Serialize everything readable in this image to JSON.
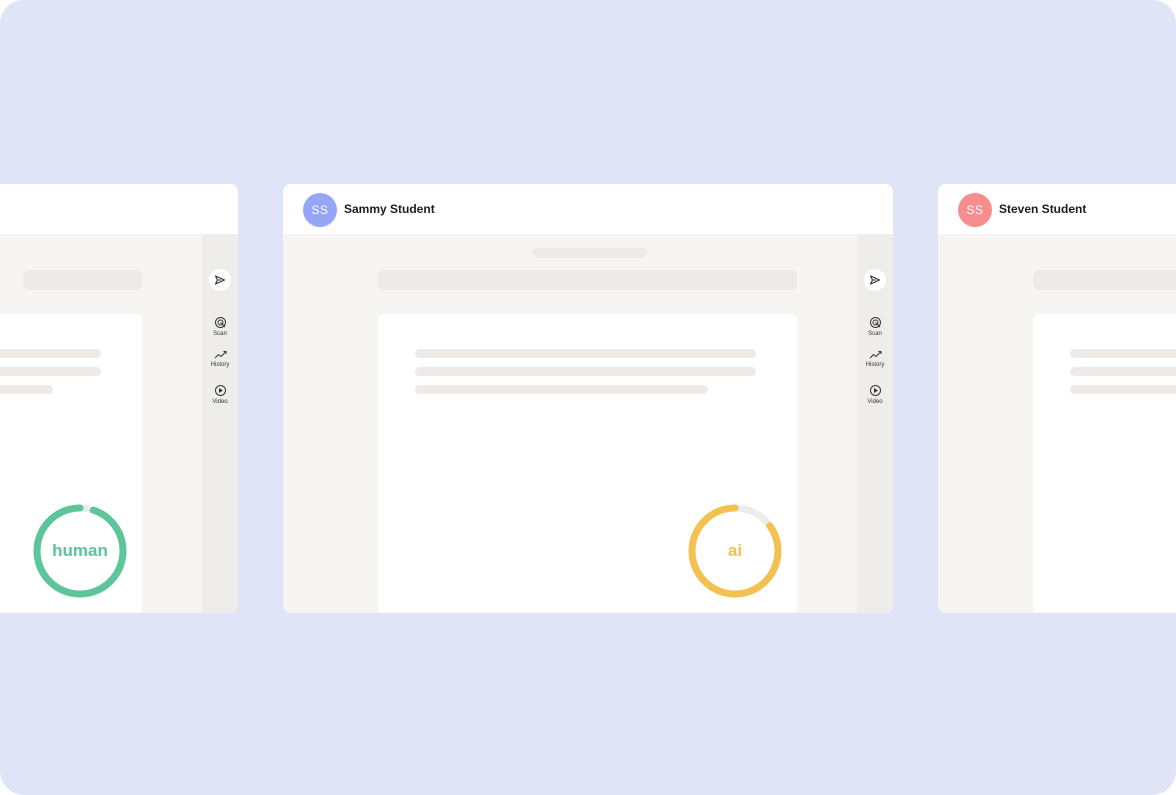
{
  "colors": {
    "background": "#dfe5f6",
    "human": "#5cc69a",
    "ai": "#f3c14f",
    "avatar_blue": "#96a5f8",
    "avatar_red": "#f78d8d",
    "ring_track": "#ececec"
  },
  "cards": {
    "center": {
      "avatar_initials": "SS",
      "student_name": "Sammy Student",
      "result_label": "ai",
      "result_level": 0.85
    },
    "left": {
      "result_label": "human",
      "result_level": 0.95
    },
    "right": {
      "avatar_initials": "SS",
      "student_name": "Steven Student"
    }
  },
  "sidebar": {
    "send_icon": "send-icon",
    "items": [
      {
        "label": "Scan",
        "icon": "scan-icon"
      },
      {
        "label": "History",
        "icon": "history-icon"
      },
      {
        "label": "Video",
        "icon": "video-icon"
      }
    ]
  }
}
